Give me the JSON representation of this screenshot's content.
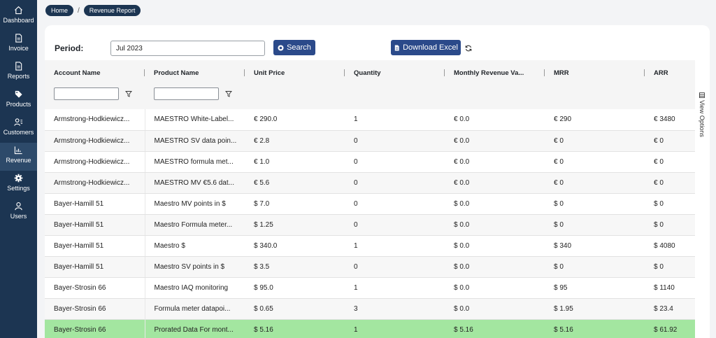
{
  "sidebar": {
    "items": [
      {
        "label": "Dashboard",
        "icon": "home-icon"
      },
      {
        "label": "Invoice",
        "icon": "document-icon"
      },
      {
        "label": "Reports",
        "icon": "document-icon"
      },
      {
        "label": "Products",
        "icon": "tag-icon"
      },
      {
        "label": "Customers",
        "icon": "customers-icon"
      },
      {
        "label": "Revenue",
        "icon": "chart-icon",
        "active": true
      },
      {
        "label": "Settings",
        "icon": "gear-icon"
      },
      {
        "label": "Users",
        "icon": "user-icon"
      }
    ]
  },
  "breadcrumb": {
    "home": "Home",
    "separator": "/",
    "current": "Revenue Report"
  },
  "toolbar": {
    "period_label": "Period:",
    "period_value": "Jul 2023",
    "search_label": "Search",
    "download_label": "Download Excel",
    "view_options_label": "View Options"
  },
  "table": {
    "columns": [
      "Account Name",
      "Product Name",
      "Unit Price",
      "Quantity",
      "Monthly Revenue Va...",
      "MRR",
      "ARR"
    ],
    "rows": [
      {
        "account": "Armstrong-Hodkiewicz...",
        "product": "MAESTRO White-Label...",
        "unit_price": "€ 290.0",
        "quantity": "1",
        "monthly_revenue": "€ 0.0",
        "mrr": "€ 290",
        "arr": "€ 3480"
      },
      {
        "account": "Armstrong-Hodkiewicz...",
        "product": "MAESTRO SV data poin...",
        "unit_price": "€ 2.8",
        "quantity": "0",
        "monthly_revenue": "€ 0.0",
        "mrr": "€ 0",
        "arr": "€ 0"
      },
      {
        "account": "Armstrong-Hodkiewicz...",
        "product": "MAESTRO formula met...",
        "unit_price": "€ 1.0",
        "quantity": "0",
        "monthly_revenue": "€ 0.0",
        "mrr": "€ 0",
        "arr": "€ 0"
      },
      {
        "account": "Armstrong-Hodkiewicz...",
        "product": "MAESTRO MV €5.6 dat...",
        "unit_price": "€ 5.6",
        "quantity": "0",
        "monthly_revenue": "€ 0.0",
        "mrr": "€ 0",
        "arr": "€ 0"
      },
      {
        "account": "Bayer-Hamill 51",
        "product": "Maestro MV points in $",
        "unit_price": "$ 7.0",
        "quantity": "0",
        "monthly_revenue": "$ 0.0",
        "mrr": "$ 0",
        "arr": "$ 0"
      },
      {
        "account": "Bayer-Hamill 51",
        "product": "Maestro Formula meter...",
        "unit_price": "$ 1.25",
        "quantity": "0",
        "monthly_revenue": "$ 0.0",
        "mrr": "$ 0",
        "arr": "$ 0"
      },
      {
        "account": "Bayer-Hamill 51",
        "product": "Maestro $",
        "unit_price": "$ 340.0",
        "quantity": "1",
        "monthly_revenue": "$ 0.0",
        "mrr": "$ 340",
        "arr": "$ 4080"
      },
      {
        "account": "Bayer-Hamill 51",
        "product": "Maestro SV points in $",
        "unit_price": "$ 3.5",
        "quantity": "0",
        "monthly_revenue": "$ 0.0",
        "mrr": "$ 0",
        "arr": "$ 0"
      },
      {
        "account": "Bayer-Strosin 66",
        "product": "Maestro IAQ monitoring",
        "unit_price": "$ 95.0",
        "quantity": "1",
        "monthly_revenue": "$ 0.0",
        "mrr": "$ 95",
        "arr": "$ 1140"
      },
      {
        "account": "Bayer-Strosin 66",
        "product": "Formula meter datapoi...",
        "unit_price": "$ 0.65",
        "quantity": "3",
        "monthly_revenue": "$ 0.0",
        "mrr": "$ 1.95",
        "arr": "$ 23.4"
      },
      {
        "account": "Bayer-Strosin 66",
        "product": "Prorated Data For mont...",
        "unit_price": "$ 5.16",
        "quantity": "1",
        "monthly_revenue": "$ 5.16",
        "mrr": "$ 5.16",
        "arr": "$ 61.92",
        "highlight": true
      }
    ]
  },
  "colors": {
    "sidebar": "#1c3552",
    "button": "#2b4a8a",
    "highlight_row": "#a3e6a0"
  }
}
